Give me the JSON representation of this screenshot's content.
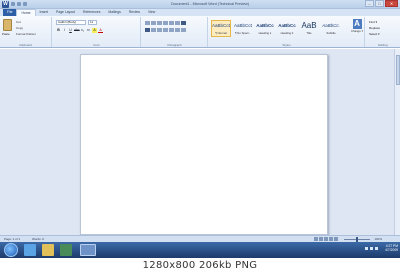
{
  "app": {
    "title": "Document1 - Microsoft Word (Technical Preview)",
    "file_button": "W"
  },
  "window_controls": {
    "minimize": "–",
    "maximize": "□",
    "close": "✕"
  },
  "tabs": [
    "File",
    "Home",
    "Insert",
    "Page Layout",
    "References",
    "Mailings",
    "Review",
    "View"
  ],
  "ribbon": {
    "clipboard": {
      "paste": "Paste",
      "cut": "Cut",
      "copy": "Copy",
      "format_painter": "Format Painter",
      "label": "Clipboard"
    },
    "font": {
      "name": "Calibri (Body)",
      "size": "11",
      "buttons": [
        "B",
        "I",
        "U",
        "abc",
        "x₂",
        "x²",
        "A",
        "A"
      ],
      "label": "Font"
    },
    "paragraph": {
      "label": "Paragraph"
    },
    "styles": {
      "items": [
        {
          "sample": "AaBbCcDc",
          "name": "¶ Normal"
        },
        {
          "sample": "AaBbCcDc",
          "name": "¶ No Spaci..."
        },
        {
          "sample": "AaBbCc",
          "name": "Heading 1"
        },
        {
          "sample": "AaBbCc",
          "name": "Heading 2"
        },
        {
          "sample": "AaB",
          "name": "Title"
        },
        {
          "sample": "AaBbCc.",
          "name": "Subtitle"
        }
      ],
      "change_styles": "Change Styles",
      "label": "Styles"
    },
    "editing": {
      "find": "Find ▾",
      "replace": "Replace",
      "select": "Select ▾",
      "label": "Editing"
    }
  },
  "statusbar": {
    "page": "Page: 1 of 1",
    "words": "Words: 0",
    "zoom": "100%"
  },
  "taskbar": {
    "time": "4:27 PM",
    "date": "4/7/2009"
  },
  "caption": "1280x800  206kb  PNG",
  "colors": {
    "accent": "#2b5797",
    "ribbon": "#e2ebf7",
    "doc_background": "#dde6f2",
    "taskbar": "#1c3b6b"
  }
}
